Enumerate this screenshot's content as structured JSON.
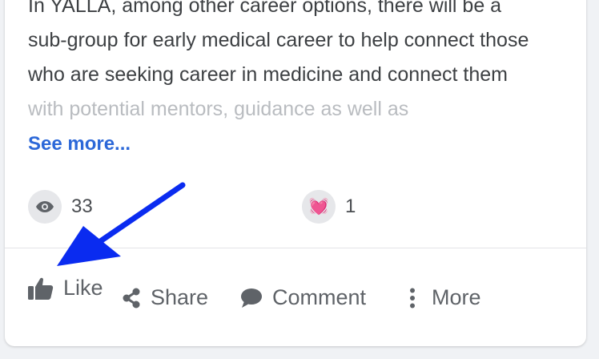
{
  "post": {
    "lines": [
      "In YALLA, among other career options, there will be a",
      "sub-group for early medical career to help connect those",
      "who are seeking career in medicine and connect them",
      "with potential mentors, guidance as well as"
    ],
    "see_more": "See more..."
  },
  "stats": {
    "views": {
      "icon": "eye-icon",
      "count": "33"
    },
    "reactions": {
      "icon": "heart-emoji",
      "emoji": "💓",
      "count": "1"
    }
  },
  "actions": {
    "like": "Like",
    "share": "Share",
    "comment": "Comment",
    "more": "More"
  },
  "colors": {
    "link": "#2c68d8",
    "annotation_arrow": "#0a2bf0"
  }
}
